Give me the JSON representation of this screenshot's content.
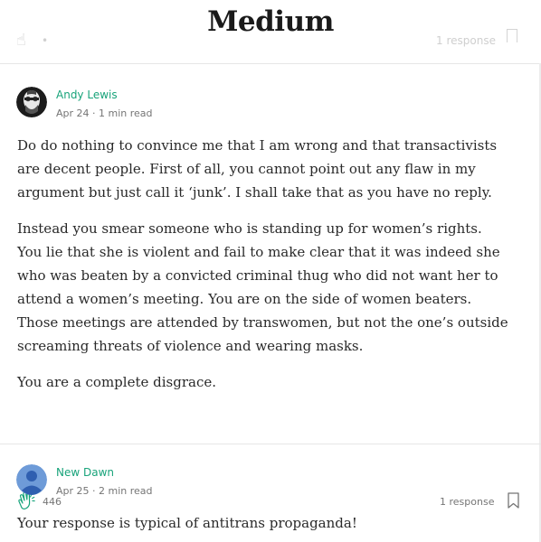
{
  "app": {
    "logo": "Medium"
  },
  "header_faded": {
    "response_label": "1 response"
  },
  "posts": [
    {
      "author": "Andy Lewis",
      "date": "Apr 24",
      "read_time": "1 min read",
      "meta_text": "Apr 24 · 1 min read",
      "paragraphs": [
        "Do do nothing to convince me that I am wrong and that transactivists are decent people. First of all, you cannot point out any flaw in my argument but just call it ‘junk’. I shall take that as you have no reply.",
        "Instead you smear someone who is standing up for women’s rights. You lie that she is violent and fail to make clear that it was indeed she who was beaten by a convicted criminal thug who did not want her to attend a women’s meeting. You are on the side of women beaters. Those meetings are attended by transwomen, but not the one’s outside screaming threats of violence and wearing masks.",
        "You are a complete disgrace."
      ],
      "claps": "446",
      "responses": "1 response",
      "icons": {
        "clap": "clap-icon",
        "bookmark": "bookmark-icon",
        "avatar": "avatar-photo"
      }
    },
    {
      "author": "New Dawn",
      "meta_text": "Apr 25 · 2 min read",
      "paragraphs": [
        "Your response is typical of antitrans propaganda!"
      ],
      "icons": {
        "avatar": "default-avatar-icon"
      }
    }
  ],
  "colors": {
    "author_green": "#18a37a",
    "meta_gray": "#757575",
    "text": "#292929",
    "default_avatar_bg": "#6e9bd8"
  }
}
